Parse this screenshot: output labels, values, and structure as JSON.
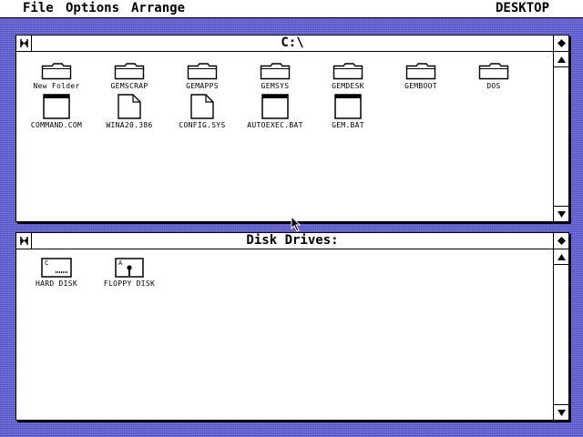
{
  "menubar": {
    "items": [
      {
        "label": "File"
      },
      {
        "label": "Options"
      },
      {
        "label": "Arrange"
      }
    ],
    "desk_label": "DESKTOP"
  },
  "window_c": {
    "title": "C:\\",
    "folders": [
      {
        "label": "New Folder",
        "icon": "folder-icon"
      },
      {
        "label": "GEMSCRAP",
        "icon": "folder-icon"
      },
      {
        "label": "GEMAPPS",
        "icon": "folder-icon"
      },
      {
        "label": "GEMSYS",
        "icon": "folder-icon"
      },
      {
        "label": "GEMDESK",
        "icon": "folder-icon"
      },
      {
        "label": "GEMBOOT",
        "icon": "folder-icon"
      },
      {
        "label": "DOS",
        "icon": "folder-icon"
      }
    ],
    "files": [
      {
        "label": "COMMAND.COM",
        "icon": "document-icon"
      },
      {
        "label": "WINA20.386",
        "icon": "dogeared-document-icon"
      },
      {
        "label": "CONFIG.SYS",
        "icon": "dogeared-document-icon"
      },
      {
        "label": "AUTOEXEC.BAT",
        "icon": "document-icon"
      },
      {
        "label": "GEM.BAT",
        "icon": "document-icon"
      }
    ]
  },
  "window_drives": {
    "title": "Disk Drives:",
    "drives": [
      {
        "label": "HARD DISK",
        "letter": "C",
        "icon": "hard-disk-icon"
      },
      {
        "label": "FLOPPY DISK",
        "letter": "A",
        "icon": "floppy-disk-icon"
      }
    ]
  },
  "colors": {
    "desktop": "#5a5ad8",
    "window": "#ffffff",
    "ink": "#000000"
  }
}
